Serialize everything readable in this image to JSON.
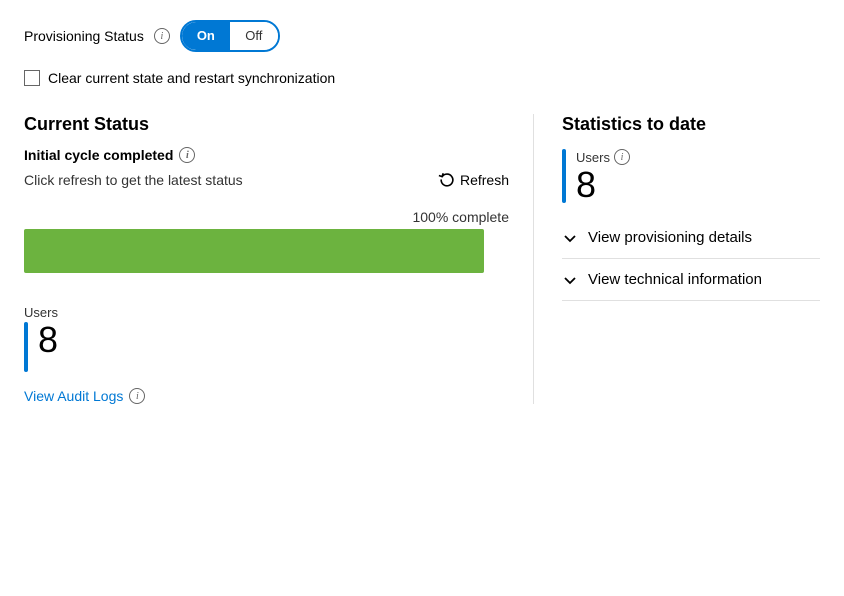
{
  "provisioning_status": {
    "label": "Provisioning Status",
    "toggle_on": "On",
    "toggle_off": "Off",
    "info_icon": "i"
  },
  "checkbox": {
    "label": "Clear current state and restart synchronization"
  },
  "left": {
    "current_status_title": "Current Status",
    "initial_cycle_label": "Initial cycle completed",
    "refresh_hint": "Click refresh to get the latest status",
    "refresh_btn_label": "Refresh",
    "progress_label": "100% complete",
    "progress_pct": 100,
    "users_label": "Users",
    "users_count": "8"
  },
  "view_audit": {
    "link_text": "View Audit Logs",
    "info_icon": "i"
  },
  "right": {
    "stats_title": "Statistics to date",
    "users_label": "Users",
    "users_count": "8",
    "info_icon": "i",
    "expand_items": [
      {
        "label": "View provisioning details"
      },
      {
        "label": "View technical information"
      }
    ]
  }
}
